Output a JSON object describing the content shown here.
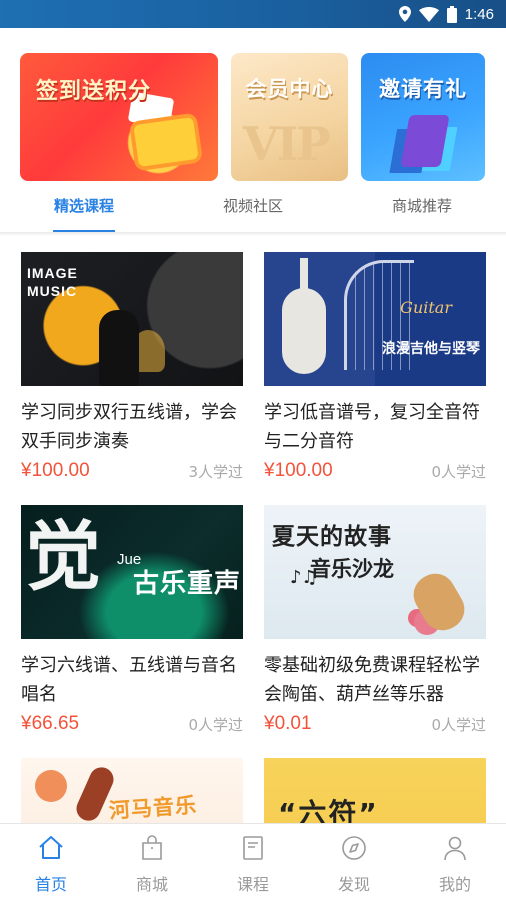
{
  "status_bar": {
    "time": "1:46",
    "icons": [
      "location-icon",
      "wifi-icon",
      "battery-icon"
    ]
  },
  "banners": [
    {
      "text": "签到送积分"
    },
    {
      "text": "会员中心",
      "art_text": "VIP"
    },
    {
      "text": "邀请有礼"
    }
  ],
  "tabs": [
    {
      "label": "精选课程",
      "active": true
    },
    {
      "label": "视频社区",
      "active": false
    },
    {
      "label": "商城推荐",
      "active": false
    }
  ],
  "courses": [
    {
      "title": "学习同步双行五线谱，学会 双手同步演奏",
      "price": "¥100.00",
      "learners": "3人学过",
      "thumb_text": "IMAGE\nMUSIC"
    },
    {
      "title": "学习低音谱号，复习全音符 与二分音符",
      "price": "¥100.00",
      "learners": "0人学过",
      "thumb_script": "Guitar",
      "thumb_caption": "浪漫吉他与竖琴"
    },
    {
      "title": "学习六线谱、五线谱与音名 唱名",
      "price": "¥66.65",
      "learners": "0人学过",
      "thumb_big": "觉",
      "thumb_small": "Jue",
      "thumb_caption": "古乐重声"
    },
    {
      "title": "零基础初级免费课程轻松学会陶笛、葫芦丝等乐器",
      "price": "¥0.01",
      "learners": "0人学过",
      "thumb_line1": "夏天的故事",
      "thumb_line2": "音乐沙龙",
      "thumb_notes": "♪♫"
    },
    {
      "thumb_text": "河马音乐"
    },
    {
      "thumb_text": "“六符”"
    }
  ],
  "bottom_nav": [
    {
      "label": "首页",
      "icon": "home-icon",
      "active": true
    },
    {
      "label": "商城",
      "icon": "shopping-bag-icon",
      "active": false
    },
    {
      "label": "课程",
      "icon": "book-icon",
      "active": false
    },
    {
      "label": "发现",
      "icon": "compass-icon",
      "active": false
    },
    {
      "label": "我的",
      "icon": "user-icon",
      "active": false
    }
  ],
  "colors": {
    "accent": "#2a82e4",
    "price": "#f2533b",
    "status_bar": "#1a5f9e"
  }
}
